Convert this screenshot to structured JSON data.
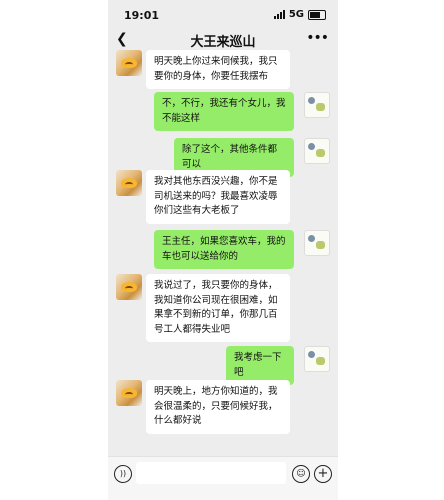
{
  "status_bar": {
    "time": "19:01",
    "network": "5G"
  },
  "chat": {
    "title": "大王来巡山"
  },
  "messages": [
    {
      "side": "in",
      "text": "明天晚上你过来伺候我，我只要你的身体，你要任我摆布"
    },
    {
      "side": "out",
      "text": "不，不行，我还有个女儿，我不能这样"
    },
    {
      "side": "out",
      "text": "除了这个，其他条件都可以"
    },
    {
      "side": "in",
      "text": "我对其他东西没兴趣，你不是司机送来的吗？我最喜欢凌辱你们这些有大老板了"
    },
    {
      "side": "out",
      "text": "王主任，如果您喜欢车，我的车也可以送给你的"
    },
    {
      "side": "in",
      "text": "我说过了，我只要你的身体，我知道你公司现在很困难，如果拿不到新的订单，你那几百号工人都得失业吧"
    },
    {
      "side": "out",
      "text": "我考虑一下吧"
    },
    {
      "side": "in",
      "text": "明天晚上，地方你知道的，我会很温柔的，只要伺候好我，什么都好说"
    }
  ],
  "icons": {
    "back": "chevron-left-icon",
    "more": "more-dots-icon",
    "voice": "voice-icon",
    "emoji": "emoji-icon",
    "plus": "plus-icon"
  },
  "colors": {
    "background": "#ededed",
    "outgoing_bubble": "#95ec69",
    "incoming_bubble": "#ffffff"
  }
}
